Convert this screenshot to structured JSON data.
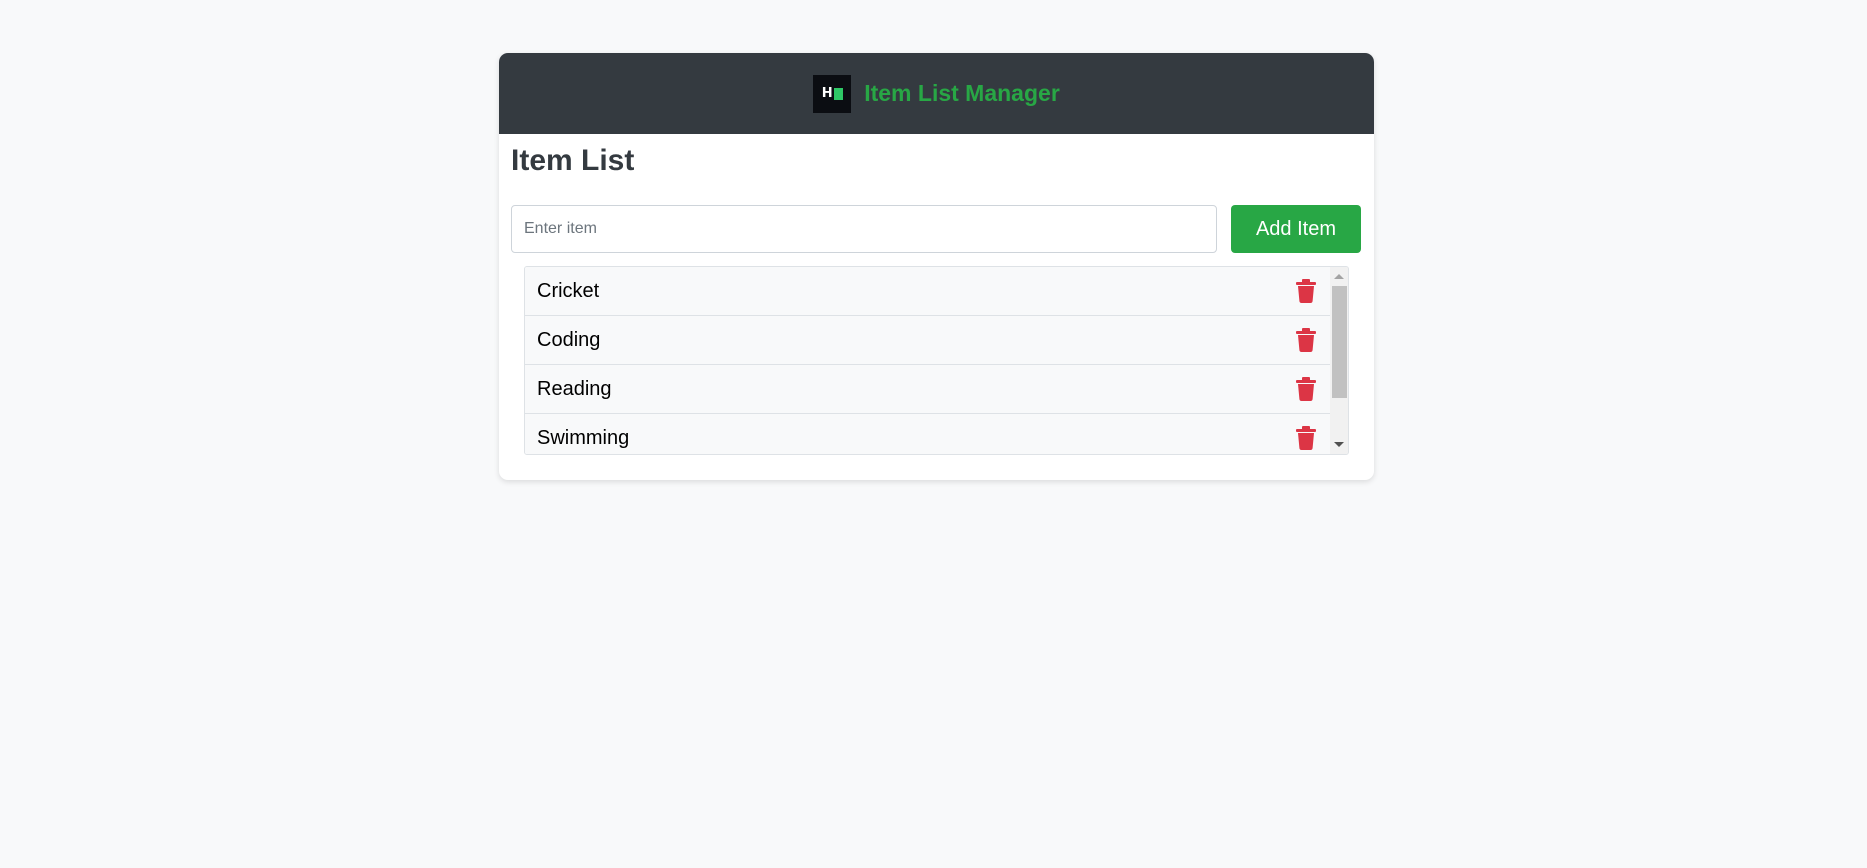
{
  "header": {
    "logo_letter": "H",
    "title": "Item List Manager"
  },
  "main": {
    "title": "Item List",
    "input_placeholder": "Enter item",
    "input_value": "",
    "add_button_label": "Add Item"
  },
  "items": [
    {
      "label": "Cricket",
      "icon": "trash-icon"
    },
    {
      "label": "Coding",
      "icon": "trash-icon"
    },
    {
      "label": "Reading",
      "icon": "trash-icon"
    },
    {
      "label": "Swimming",
      "icon": "trash-icon"
    }
  ],
  "colors": {
    "header_bg": "#343a40",
    "brand_green": "#28a745",
    "delete_red": "#dc3545"
  }
}
